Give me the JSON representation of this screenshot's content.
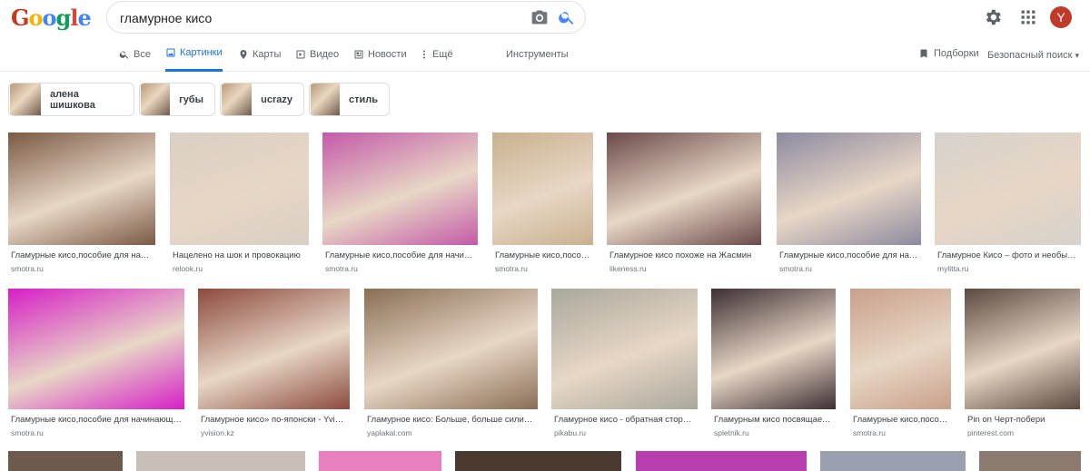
{
  "header": {
    "logo_letters": [
      "G",
      "o",
      "o",
      "g",
      "l",
      "e"
    ],
    "search_value": "гламурное кисо",
    "avatar_letter": "Y"
  },
  "tabs": [
    {
      "label": "Все",
      "icon": "search-icon",
      "active": false
    },
    {
      "label": "Картинки",
      "icon": "image-icon",
      "active": true
    },
    {
      "label": "Карты",
      "icon": "map-pin-icon",
      "active": false
    },
    {
      "label": "Видео",
      "icon": "play-icon",
      "active": false
    },
    {
      "label": "Новости",
      "icon": "news-icon",
      "active": false
    },
    {
      "label": "Ещё",
      "icon": "more-vert-icon",
      "active": false
    }
  ],
  "tools_label": "Инструменты",
  "saved_label": "Подборки",
  "safe_search_label": "Безопасный поиск",
  "chips": [
    {
      "label": "алена шишкова"
    },
    {
      "label": "губы"
    },
    {
      "label": "ucrazy"
    },
    {
      "label": "стиль"
    }
  ],
  "row1": [
    {
      "caption": "Гламурные кисо,пособие для начинающих",
      "source": "smotra.ru",
      "color": "#7a5a44"
    },
    {
      "caption": "Нацелено на шок и провокацию",
      "source": "relook.ru",
      "color": "#d9cfc4"
    },
    {
      "caption": "Гламурные кисо,пособие для начинающих",
      "source": "smotra.ru",
      "color": "#c45aa8"
    },
    {
      "caption": "Гламурные кисо,пособие",
      "source": "smotra.ru",
      "color": "#c9b18e"
    },
    {
      "caption": "Гламурное кисо похоже на Жасмин",
      "source": "likeness.ru",
      "color": "#6b4a4a"
    },
    {
      "caption": "Гламурные кисо,пособие для начинающих",
      "source": "smotra.ru",
      "color": "#8d8aa0"
    },
    {
      "caption": "Гламурное Кисо – фото и необычные",
      "source": "mylitta.ru",
      "color": "#d6d2cc"
    }
  ],
  "row2": [
    {
      "caption": "Гламурные кисо,пособие для начинающих",
      "source": "smotra.ru",
      "color": "#d61fc6"
    },
    {
      "caption": "Гламурное кисо» по-японски - Yvision",
      "source": "yvision.kz",
      "color": "#8c4a3e"
    },
    {
      "caption": "Гламурное кисо: Больше, больше силикона",
      "source": "yaplakal.com",
      "color": "#8a6e55"
    },
    {
      "caption": "Гламурное кисо - обратная сторона",
      "source": "pikabu.ru",
      "color": "#a9a89c"
    },
    {
      "caption": "Гламурным кисо посвящается",
      "source": "spletnik.ru",
      "color": "#3d2f33"
    },
    {
      "caption": "Гламурные кисо,пособие",
      "source": "smotra.ru",
      "color": "#c9a08a"
    },
    {
      "caption": "Pin on Черт-побери",
      "source": "pinterest.com",
      "color": "#5a4a40"
    }
  ]
}
